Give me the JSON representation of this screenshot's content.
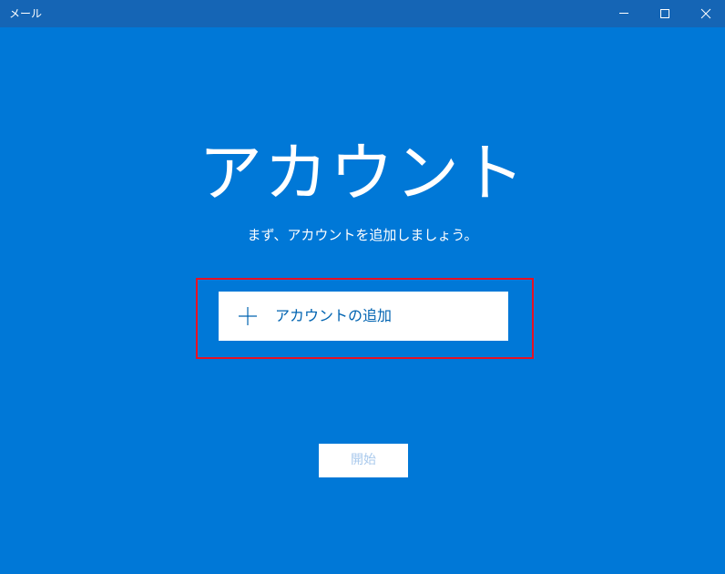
{
  "window": {
    "title": "メール",
    "controls": {
      "minimize": "minimize-icon",
      "maximize": "maximize-icon",
      "close": "close-icon"
    }
  },
  "main": {
    "heading": "アカウント",
    "subtitle": "まず、アカウントを追加しましょう。",
    "add_account": {
      "icon": "plus-icon",
      "label": "アカウントの追加"
    },
    "start_button": {
      "label": "開始",
      "enabled": false
    }
  },
  "colors": {
    "background": "#0078d7",
    "titlebar": "#1565b5",
    "accent_text": "#0063b1",
    "highlight": "#e81123",
    "disabled_text": "#a9c9ec"
  }
}
